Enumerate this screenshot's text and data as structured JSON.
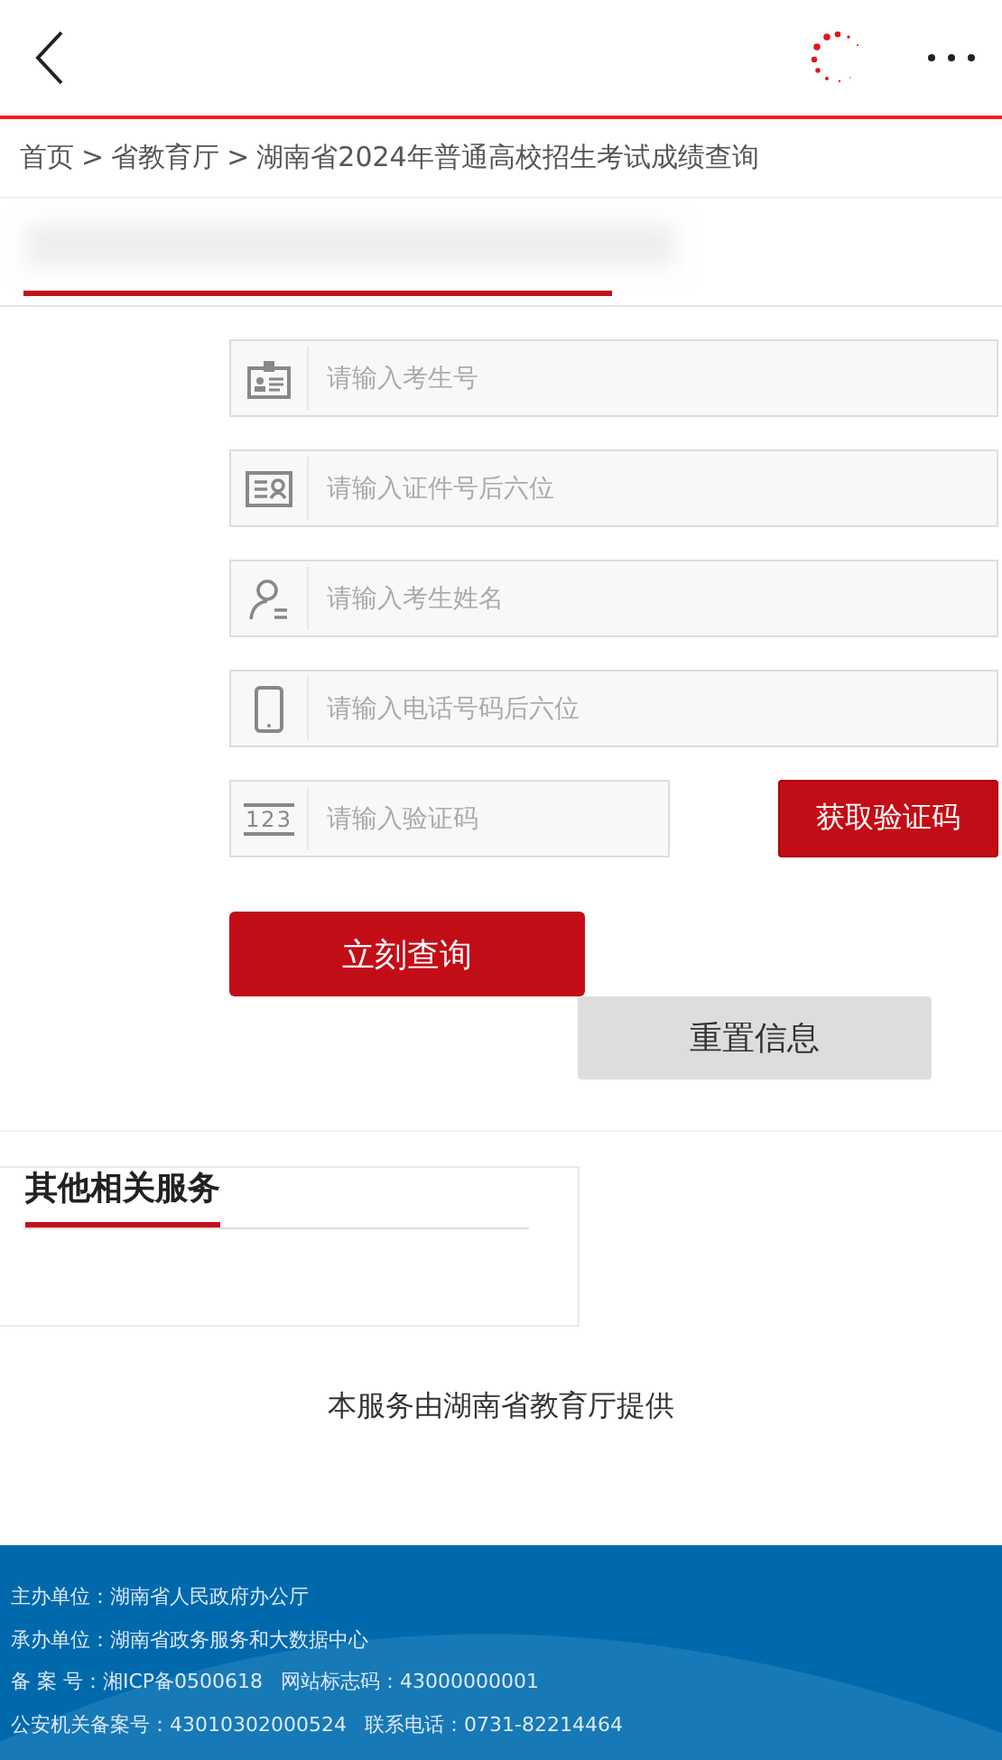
{
  "breadcrumb": [
    "首页",
    ">",
    "省教育厅",
    ">",
    "湖南省2024年普通高校招生考试成绩查询"
  ],
  "form": {
    "fields": [
      {
        "kind": "badge",
        "placeholder": "请输入考生号"
      },
      {
        "kind": "card",
        "placeholder": "请输入证件号后六位"
      },
      {
        "kind": "person",
        "placeholder": "请输入考生姓名"
      },
      {
        "kind": "phone",
        "placeholder": "请输入电话号码后六位"
      },
      {
        "kind": "code",
        "icon_text": "123",
        "placeholder": "请输入验证码",
        "button": "获取验证码"
      }
    ],
    "submit": "立刻查询",
    "reset": "重置信息"
  },
  "related": {
    "title": "其他相关服务"
  },
  "provider": "本服务由湖南省教育厅提供",
  "footer": [
    [
      "主办单位：湖南省人民政府办公厅"
    ],
    [
      "承办单位：湖南省政务服务和大数据中心"
    ],
    [
      "备 案 号：湘ICP备0500618",
      "网站标志码：43000000001"
    ],
    [
      "公安机关备案号：43010302000524",
      "联系电话：0731-82214464"
    ]
  ]
}
